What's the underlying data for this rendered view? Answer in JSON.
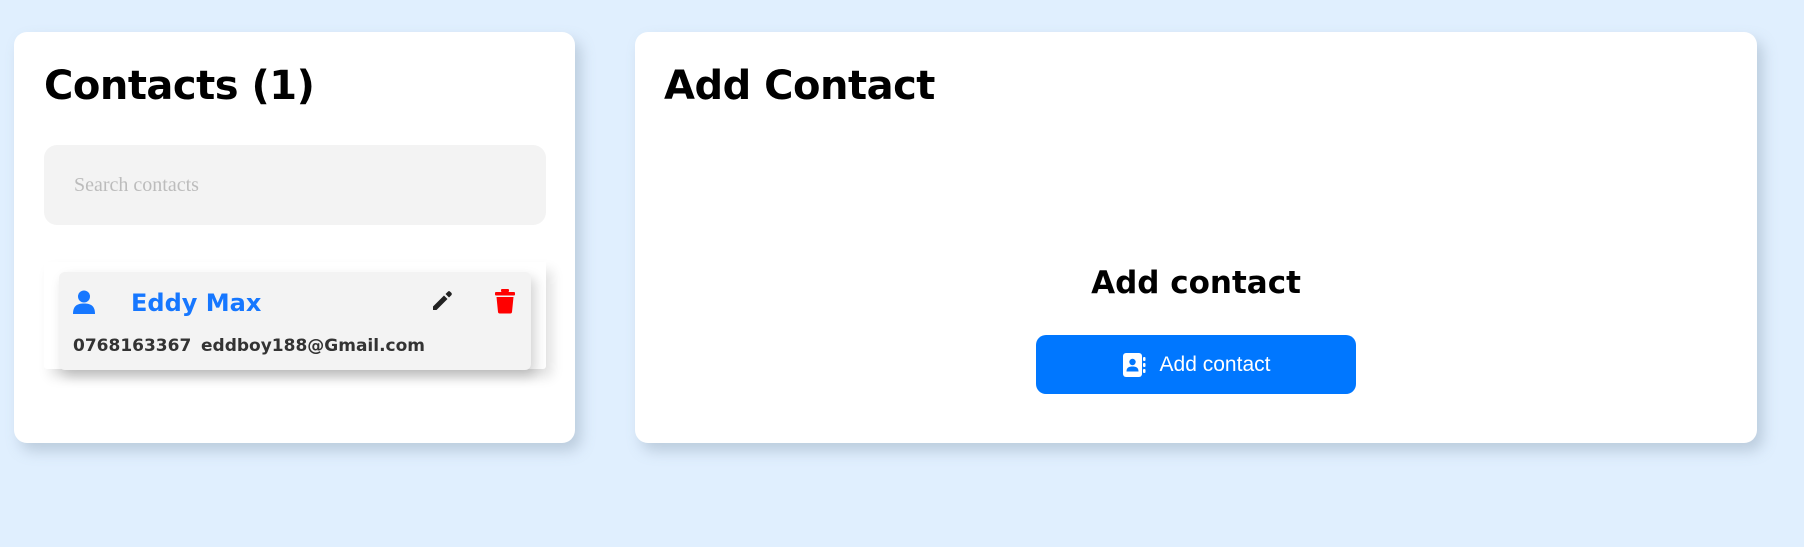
{
  "contacts_panel": {
    "title": "Contacts (1)",
    "search": {
      "placeholder": "Search contacts",
      "value": ""
    },
    "contacts": [
      {
        "name": "Eddy Max",
        "phone": "0768163367",
        "email": "eddboy188@Gmail.com",
        "icon": "person-icon",
        "edit_icon": "pencil-icon",
        "delete_icon": "trash-icon"
      }
    ]
  },
  "add_panel": {
    "title": "Add Contact",
    "subtitle": "Add contact",
    "button_label": "Add contact",
    "button_icon": "address-book-icon"
  },
  "colors": {
    "background": "#e0effe",
    "accent": "#1677ff",
    "button": "#0077ff",
    "delete": "#ff0000",
    "edit": "#222222"
  }
}
